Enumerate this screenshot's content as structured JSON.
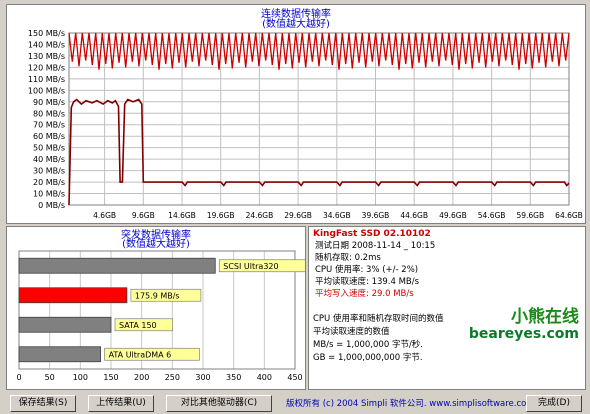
{
  "top_chart": {
    "title": "连续数据传输率",
    "subtitle": "(数值越大越好)"
  },
  "burst_chart": {
    "title": "突发数据传输率",
    "subtitle": "(数值越大越好)"
  },
  "info": {
    "device": "KingFast SSD 02.10102",
    "rows": [
      {
        "label": "测试日期 2008-11-14 _ 10:15",
        "red": false
      },
      {
        "label": "随机存取: 0.2ms",
        "red": false
      },
      {
        "label": "CPU 使用率: 3% (+/- 2%)",
        "red": false
      },
      {
        "label": "平均读取速度: 139.4 MB/s",
        "red": false
      },
      {
        "label": "平均写入速度: 29.0 MB/s",
        "red": true
      }
    ],
    "note_lines": [
      "CPU 使用率和随机存取时间的数值",
      "平均读取速度的数值",
      "MB/s = 1,000,000 字节/秒.",
      "GB = 1,000,000,000 字节."
    ]
  },
  "watermark": {
    "line1": "小熊在线",
    "line2": "beareyes.com"
  },
  "buttons": {
    "save": "保存结果(S)",
    "upload": "上传结果(U)",
    "compare": "对比其他驱动器(C)",
    "done": "完成(D)"
  },
  "footer": "版权所有 (c) 2004 Simpli 软件公司. www.simplisoftware.com",
  "chart_data": [
    {
      "type": "line",
      "title": "连续数据传输率",
      "subtitle": "(数值越大越好)",
      "ylabel": "MB/s",
      "ylim": [
        0,
        150
      ],
      "yticks": [
        0,
        10,
        20,
        30,
        40,
        50,
        60,
        70,
        80,
        90,
        100,
        110,
        120,
        130,
        140,
        150
      ],
      "ytick_labels": [
        "0 MB/s",
        "10 MB/s",
        "20 MB/s",
        "30 MB/s",
        "40 MB/s",
        "50 MB/s",
        "60 MB/s",
        "70 MB/s",
        "80 MB/s",
        "90 MB/s",
        "100 MB/s",
        "110 MB/s",
        "120 MB/s",
        "130 MB/s",
        "140 MB/s",
        "150 MB/s"
      ],
      "xlim": [
        0,
        64.6
      ],
      "xticks": [
        4.6,
        9.6,
        14.6,
        19.6,
        24.6,
        29.6,
        34.6,
        39.6,
        44.6,
        49.6,
        54.6,
        59.6,
        64.6
      ],
      "xtick_labels": [
        "4.6GB",
        "9.6GB",
        "14.6GB",
        "19.6GB",
        "24.6GB",
        "29.6GB",
        "34.6GB",
        "39.6GB",
        "44.6GB",
        "49.6GB",
        "54.6GB",
        "59.6GB",
        "64.6GB"
      ],
      "grid": true,
      "colors": {
        "read": "#cc0000",
        "write": "#800000"
      },
      "series": [
        {
          "key": "read",
          "oscillation_min": 118,
          "oscillation_max": 150
        },
        {
          "key": "write",
          "values": [
            [
              0,
              0
            ],
            [
              0.3,
              85
            ],
            [
              0.6,
              90
            ],
            [
              1,
              92
            ],
            [
              1.6,
              88
            ],
            [
              2.2,
              91
            ],
            [
              3,
              89
            ],
            [
              3.6,
              91
            ],
            [
              4.4,
              88
            ],
            [
              5.0,
              91
            ],
            [
              5.6,
              89
            ],
            [
              6.0,
              91
            ],
            [
              6.4,
              86
            ],
            [
              6.6,
              20
            ],
            [
              6.9,
              20
            ],
            [
              7.2,
              88
            ],
            [
              7.6,
              92
            ],
            [
              8.3,
              90
            ],
            [
              9.0,
              92
            ],
            [
              9.4,
              88
            ],
            [
              9.6,
              20
            ],
            [
              14.6,
              20
            ],
            [
              15.0,
              17
            ],
            [
              15.3,
              20
            ],
            [
              19.6,
              20
            ],
            [
              20.0,
              17
            ],
            [
              20.3,
              20
            ],
            [
              24.6,
              20
            ],
            [
              25.0,
              17
            ],
            [
              25.3,
              20
            ],
            [
              29.6,
              20
            ],
            [
              30.0,
              17
            ],
            [
              30.3,
              20
            ],
            [
              34.6,
              20
            ],
            [
              35.0,
              17
            ],
            [
              35.3,
              20
            ],
            [
              39.6,
              20
            ],
            [
              40.0,
              17
            ],
            [
              40.3,
              20
            ],
            [
              44.6,
              20
            ],
            [
              45.0,
              17
            ],
            [
              45.3,
              20
            ],
            [
              49.6,
              20
            ],
            [
              50.0,
              17
            ],
            [
              50.3,
              20
            ],
            [
              54.6,
              20
            ],
            [
              55.0,
              17
            ],
            [
              55.3,
              20
            ],
            [
              59.6,
              20
            ],
            [
              60.0,
              17
            ],
            [
              60.3,
              20
            ],
            [
              64.0,
              20
            ],
            [
              64.3,
              17
            ],
            [
              64.6,
              19
            ]
          ]
        }
      ]
    },
    {
      "type": "bar",
      "title": "突发数据传输率",
      "subtitle": "(数值越大越好)",
      "orientation": "horizontal",
      "xlim": [
        0,
        450
      ],
      "xticks": [
        0,
        50,
        100,
        150,
        200,
        250,
        300,
        350,
        400,
        450
      ],
      "grid": true,
      "categories": [
        "SCSI Ultra320",
        "175.9 MB/s",
        "SATA 150",
        "ATA UltraDMA 6"
      ],
      "values": [
        320,
        175.9,
        150,
        133
      ],
      "bar_colors": [
        "#808080",
        "#ff0000",
        "#808080",
        "#808080"
      ],
      "label_bg": "#ffff99"
    }
  ]
}
